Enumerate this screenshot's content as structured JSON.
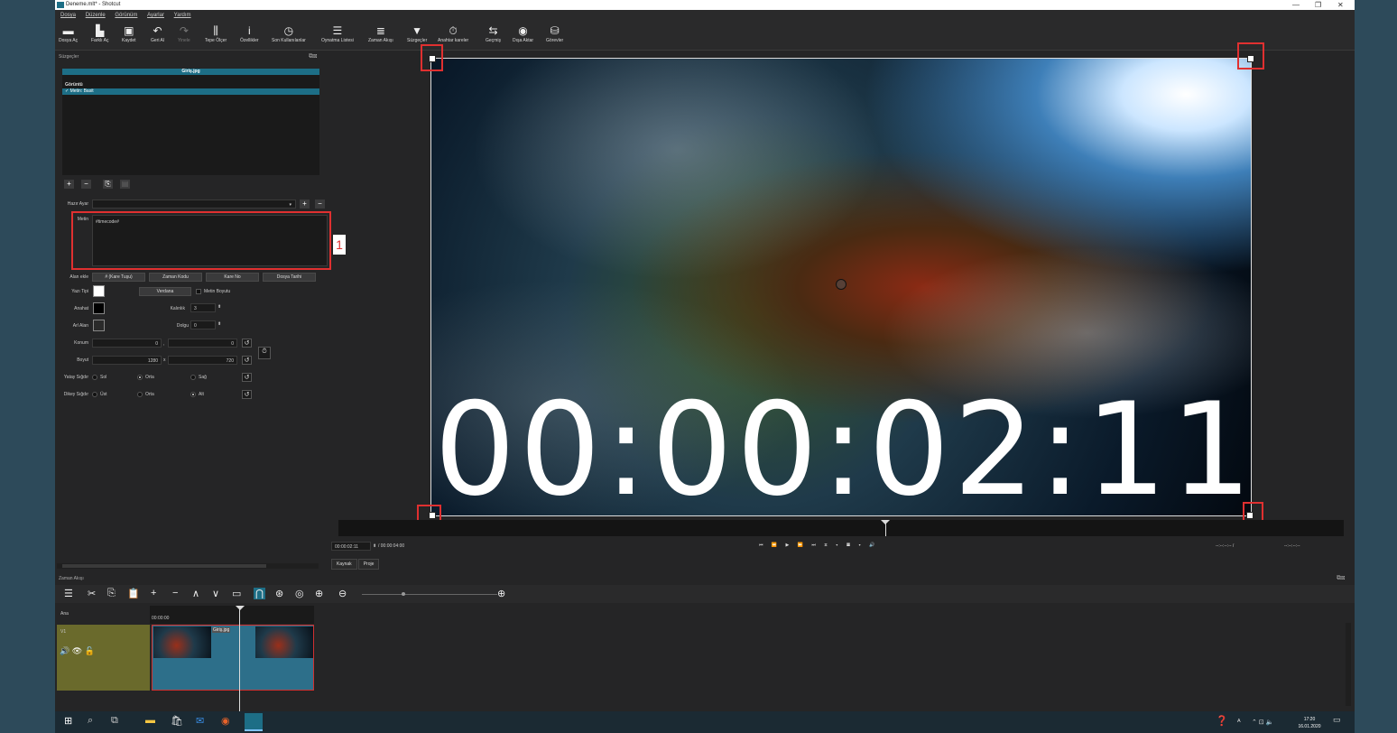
{
  "window": {
    "title": "Deneme.mlt* - Shotcut",
    "controls": [
      "—",
      "❐",
      "✕"
    ]
  },
  "menu": [
    "Dosya",
    "Düzenle",
    "Görünüm",
    "Ayarlar",
    "Yardım"
  ],
  "toolbar": [
    {
      "icon": "open-icon",
      "glyph": "▬",
      "label": "Dosya Aç",
      "enabled": true
    },
    {
      "icon": "open-other-icon",
      "glyph": "▙",
      "label": "Farklı Aç",
      "enabled": true
    },
    {
      "icon": "save-icon",
      "glyph": "▣",
      "label": "Kaydet",
      "enabled": true
    },
    {
      "icon": "undo-icon",
      "glyph": "↶",
      "label": "Geri Al",
      "enabled": true
    },
    {
      "icon": "redo-icon",
      "glyph": "↷",
      "label": "Yinele",
      "enabled": false
    },
    {
      "icon": "peak-meter-icon",
      "glyph": "⫼",
      "label": "Tepe Ölçer",
      "enabled": true
    },
    {
      "icon": "properties-icon",
      "glyph": "i",
      "label": "Özellikler",
      "enabled": true
    },
    {
      "icon": "recent-icon",
      "glyph": "◷",
      "label": "Son Kullanılanlar",
      "enabled": true
    },
    {
      "icon": "playlist-icon",
      "glyph": "☰",
      "label": "Oynatma Listesi",
      "enabled": true
    },
    {
      "icon": "timeline-icon",
      "glyph": "≣",
      "label": "Zaman Akışı",
      "enabled": true
    },
    {
      "icon": "filter-icon",
      "glyph": "▼",
      "label": "Süzgeçler",
      "enabled": true
    },
    {
      "icon": "keyframes-icon",
      "glyph": "⏱",
      "label": "Anahtar kareler",
      "enabled": true
    },
    {
      "icon": "history-icon",
      "glyph": "⇆",
      "label": "Geçmiş",
      "enabled": true
    },
    {
      "icon": "export-icon",
      "glyph": "◉",
      "label": "Dışa Aktar",
      "enabled": true
    },
    {
      "icon": "jobs-icon",
      "glyph": "⛁",
      "label": "Görevler",
      "enabled": true
    }
  ],
  "filters_panel": {
    "title": "Süzgeçler",
    "clip_name": "Giriş.jpg",
    "category": "Görüntü",
    "filter_item": "✓  Metin: Basit",
    "preset_label": "Hazır Ayar",
    "text_label": "Metin",
    "text_value": "#timecode#",
    "insert_field_label": "Alan ekle",
    "insert_buttons": [
      "# (Kare Tuşu)",
      "Zaman Kodu",
      "Kare No",
      "Dosya Tarihi"
    ],
    "font_label": "Yazı Tipi",
    "font_button": "Verdana",
    "font_size_check": "Metin Boyutu",
    "outline_label": "Anahat",
    "thickness_label": "Kalınlık",
    "thickness_value": "3",
    "bg_label": "Arl Alan",
    "padding_label": "Dolgu",
    "padding_value": "0",
    "position_label": "Konum",
    "position_x": "0",
    "position_sep": ",",
    "position_y": "0",
    "size_label": "Boyut",
    "size_w": "1280",
    "size_sep": "x",
    "size_h": "720",
    "halign_label": "Yatay Sığdır",
    "halign_options": [
      "Sol",
      "Orta",
      "Sağ"
    ],
    "halign_selected": 1,
    "valign_label": "Dikey Sığdır",
    "valign_options": [
      "Üst",
      "Orta",
      "Alt"
    ],
    "valign_selected": 2,
    "annotation": "1"
  },
  "player": {
    "overlay_timecode": "00:00:02:11",
    "current_time": "00:00:02:11",
    "total_time": "/ 00:00:04:00",
    "in_point": "--:--:--:-- /",
    "out_point": "--:--:--:--",
    "transport": "⏮ ⏪ ▶ ⏩ ⏭ ⧖ ▾ ▦ ▾ 🔊",
    "tabs": [
      "Kaynak",
      "Proje"
    ]
  },
  "timeline": {
    "title": "Zaman Akışı",
    "tools": [
      "☰",
      "✂",
      "⎘",
      "📋",
      "+",
      "−",
      "∧",
      "∨",
      "▭",
      "⋂",
      "⊛",
      "◎",
      "⊕",
      "⊖"
    ],
    "zoom_in": "⊕",
    "ruler_start": "00:00:00",
    "output_track": "Ana",
    "track_name": "V1",
    "clip_name": "Giriş.jpg",
    "track_controls": "🔊 👁 🔓"
  },
  "taskbar": {
    "clock_time": "17:20",
    "clock_date": "16.01.2020",
    "tray": "⌃ ⊡ 🔈"
  }
}
